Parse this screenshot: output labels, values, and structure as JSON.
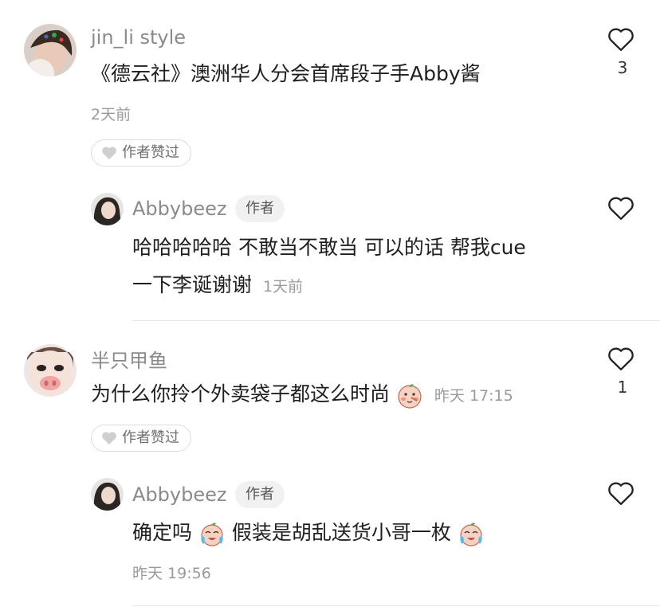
{
  "comments": [
    {
      "username": "jin_li style",
      "text": "《德云社》澳洲华人分会首席段子手Abby酱",
      "time": "2天前",
      "likes": "3",
      "liked_label": "作者赞过",
      "reply": {
        "username": "Abbybeez",
        "badge": "作者",
        "text_line1": "哈哈哈哈哈 不敢当不敢当 可以的话 帮我cue",
        "text_line2": "一下李诞谢谢",
        "time": "1天前"
      }
    },
    {
      "username": "半只甲鱼",
      "text": "为什么你拎个外卖袋子都这么时尚",
      "time": "昨天 17:15",
      "likes": "1",
      "liked_label": "作者赞过",
      "reply": {
        "username": "Abbybeez",
        "badge": "作者",
        "text_part1": "确定吗",
        "text_part2": "假装是胡乱送货小哥一枚",
        "time": "昨天 19:56"
      }
    }
  ],
  "colors": {
    "heart_stroke": "#222222",
    "pill_heart": "#cfcfcf"
  }
}
